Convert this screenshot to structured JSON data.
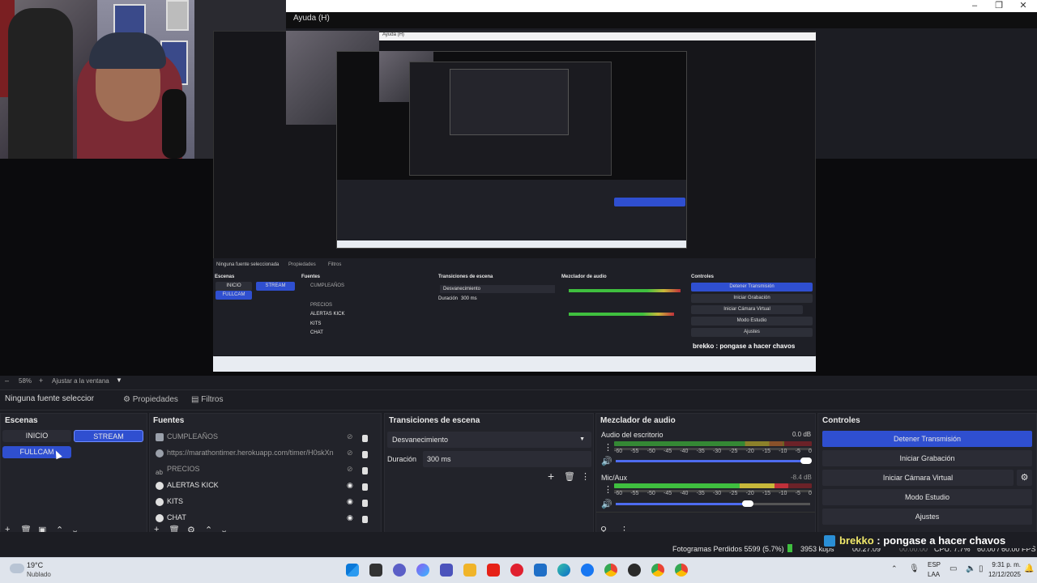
{
  "window": {
    "title": "Ayuda (H)",
    "controls": [
      "–",
      "❐",
      "✕"
    ]
  },
  "nested": {
    "title": "Ayuda (H)",
    "no_source": "Ninguna fuente seleccionada",
    "properties": "Propiedades",
    "filters": "Filtros",
    "scenes_title": "Escenas",
    "sources_title": "Fuentes",
    "transitions_title": "Transiciones de escena",
    "mixer_title": "Mezclador de audio",
    "controls_title": "Controles",
    "overlay": "brekko : pongase a hacer chavos",
    "zoom": "58%",
    "fit": "Ajustar a la ventana"
  },
  "zoom": {
    "minus": "–",
    "value": "58%",
    "plus": "+",
    "fit_label": "Ajustar a la ventana"
  },
  "source_bar": {
    "no_source": "Ninguna fuente seleccionada",
    "properties": "Propiedades",
    "filters": "Filtros"
  },
  "scenes": {
    "title": "Escenas",
    "items": [
      "INICIO",
      "STREAM",
      "FULLCAM"
    ]
  },
  "sources": {
    "title": "Fuentes",
    "items": [
      {
        "name": "CUMPLEAÑOS",
        "icon": "image-icon"
      },
      {
        "name": "https://marathontimer.herokuapp.com/timer/H0skXn",
        "icon": "globe-icon"
      },
      {
        "name": "PRECIOS",
        "icon": "text-icon"
      },
      {
        "name": "ALERTAS KICK",
        "icon": "globe-icon"
      },
      {
        "name": "KITS",
        "icon": "globe-icon"
      },
      {
        "name": "CHAT",
        "icon": "globe-icon"
      }
    ]
  },
  "transitions": {
    "title": "Transiciones de escena",
    "selected": "Desvanecimiento",
    "duration_label": "Duración",
    "duration_value": "300 ms"
  },
  "mixer": {
    "title": "Mezclador de audio",
    "tracks": [
      {
        "name": "Audio del escritorio",
        "db": "0.0 dB",
        "volume": 0.98
      },
      {
        "name": "Mic/Aux",
        "db": "-8.4 dB",
        "volume": 0.68
      }
    ],
    "ticks": [
      "-60",
      "-55",
      "-50",
      "-45",
      "-40",
      "-35",
      "-30",
      "-25",
      "-20",
      "-15",
      "-10",
      "-5",
      "0"
    ]
  },
  "controls": {
    "title": "Controles",
    "stop_stream": "Detener Transmisión",
    "start_recording": "Iniciar Grabación",
    "start_virtual_cam": "Iniciar Cámara Virtual",
    "studio_mode": "Modo Estudio",
    "settings": "Ajustes"
  },
  "overlay": {
    "user": "brekko",
    "message": " : pongase a hacer chavos"
  },
  "status": {
    "dropped_frames": "Fotogramas Perdidos 5599 (5.7%)",
    "bitrate": "3953 kbps",
    "stream_time": "00:27:09",
    "rec_time": "00:00:00",
    "cpu": "CPU: 7.7%",
    "fps": "60.00 / 60.00 FPS"
  },
  "taskbar": {
    "weather_temp": "19°C",
    "weather_desc": "Nublado",
    "lang_top": "ESP",
    "lang_bottom": "LAA",
    "time": "9:31 p. m.",
    "date": "12/12/2025"
  },
  "colors": {
    "accent_blue": "#2f4fd0",
    "dock_bg": "#22232a",
    "meter_green": "#3fbf3f",
    "meter_yellow": "#c8b83a",
    "meter_red": "#c0303a"
  }
}
